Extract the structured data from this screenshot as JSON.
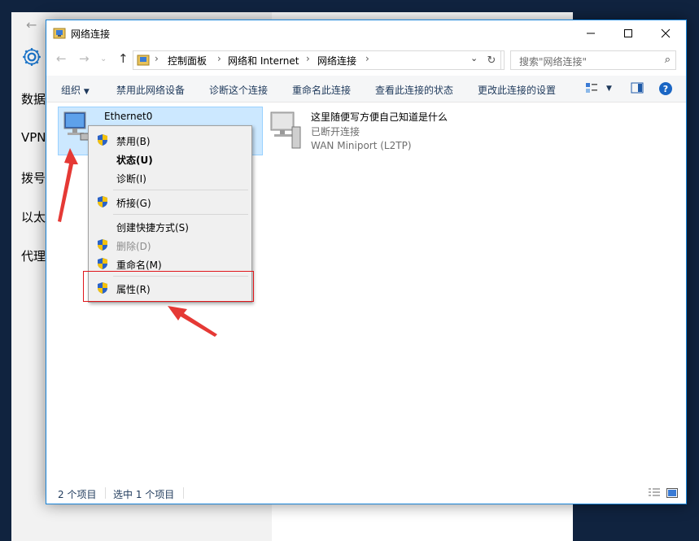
{
  "bg_settings": {
    "nav": [
      "数据",
      "VPN",
      "拨号",
      "以太",
      "代理"
    ]
  },
  "window": {
    "title": "网络连接",
    "controls": [
      "minimize",
      "maximize",
      "close"
    ]
  },
  "address": {
    "crumbs": [
      "控制面板",
      "网络和 Internet",
      "网络连接"
    ],
    "search_placeholder": "搜索\"网络连接\""
  },
  "commands": {
    "organize": "组织",
    "disable": "禁用此网络设备",
    "diagnose": "诊断这个连接",
    "rename": "重命名此连接",
    "status": "查看此连接的状态",
    "settings": "更改此连接的设置"
  },
  "items": [
    {
      "name": "Ethernet0",
      "status": "",
      "device": ""
    },
    {
      "name": "这里随便写方便自己知道是什么",
      "status": "已断开连接",
      "device": "WAN Miniport (L2TP)"
    }
  ],
  "context_menu": {
    "disable": "禁用(B)",
    "status": "状态(U)",
    "diagnose": "诊断(I)",
    "bridge": "桥接(G)",
    "shortcut": "创建快捷方式(S)",
    "delete": "删除(D)",
    "rename": "重命名(M)",
    "properties": "属性(R)"
  },
  "statusbar": {
    "count": "2 个项目",
    "selected": "选中 1 个项目"
  },
  "colors": {
    "accent": "#1883d7",
    "selection": "#cce8ff",
    "highlight_box": "#e0161b",
    "arrow": "#e53935"
  }
}
